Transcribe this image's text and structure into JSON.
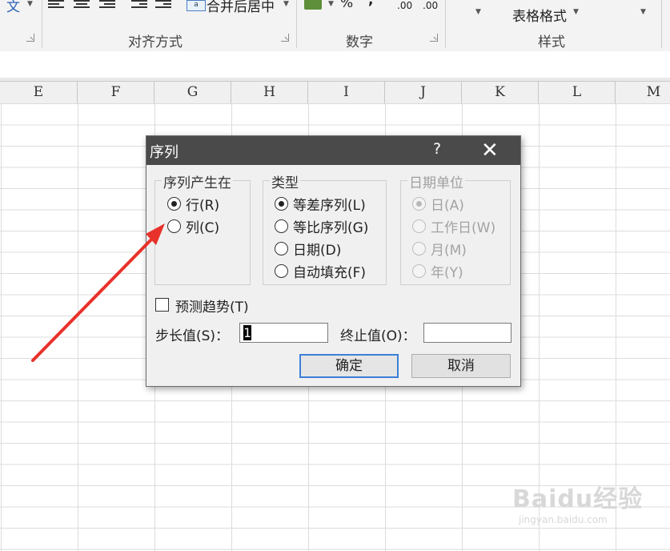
{
  "ribbon": {
    "wrap_text_fragment": "文",
    "merge_center": "合并后居中",
    "percent": "%",
    "comma": ",",
    "inc_decimal": ".00",
    "dec_decimal": ".00",
    "table_format": "表格格式",
    "groups": {
      "alignment": "对齐方式",
      "number": "数字",
      "styles": "样式"
    }
  },
  "columns": [
    "E",
    "F",
    "G",
    "H",
    "I",
    "J",
    "K",
    "L",
    "M"
  ],
  "dialog": {
    "title": "序列",
    "help": "?",
    "close": "✕",
    "series_in": {
      "legend": "序列产生在",
      "options": [
        {
          "label": "行(R)",
          "checked": true
        },
        {
          "label": "列(C)",
          "checked": false
        }
      ]
    },
    "type": {
      "legend": "类型",
      "options": [
        {
          "label": "等差序列(L)",
          "checked": true
        },
        {
          "label": "等比序列(G)",
          "checked": false
        },
        {
          "label": "日期(D)",
          "checked": false
        },
        {
          "label": "自动填充(F)",
          "checked": false
        }
      ]
    },
    "date_unit": {
      "legend": "日期单位",
      "options": [
        {
          "label": "日(A)",
          "checked": true
        },
        {
          "label": "工作日(W)",
          "checked": false
        },
        {
          "label": "月(M)",
          "checked": false
        },
        {
          "label": "年(Y)",
          "checked": false
        }
      ]
    },
    "trend": {
      "label": "预测趋势(T)",
      "checked": false
    },
    "step_label": "步长值(S)：",
    "step_value": "1",
    "stop_label": "终止值(O)：",
    "stop_value": "",
    "ok": "确定",
    "cancel": "取消"
  },
  "annotation": {
    "color": "#e8312a"
  },
  "watermark": {
    "main": "Baidu经验",
    "sub": "jingyan.baidu.com"
  }
}
